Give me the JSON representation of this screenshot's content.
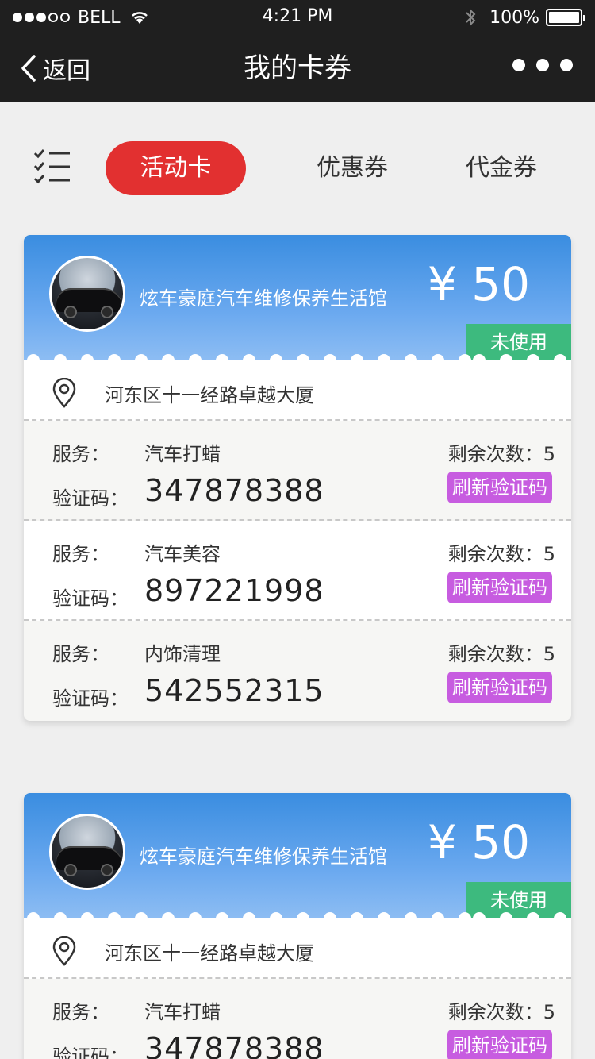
{
  "status_bar": {
    "carrier": "BELL",
    "time": "4:21 PM",
    "battery": "100%"
  },
  "nav": {
    "back_label": "返回",
    "title": "我的卡券"
  },
  "tabs": [
    {
      "label": "活动卡",
      "active": true
    },
    {
      "label": "优惠券",
      "active": false
    },
    {
      "label": "代金券",
      "active": false
    }
  ],
  "cards": [
    {
      "shop": "炫车豪庭汽车维修保养生活馆",
      "price": "¥ 50",
      "status": "未使用",
      "address": "河东区十一经路卓越大厦",
      "services": [
        {
          "service_label": "服务：",
          "name": "汽车打蜡",
          "remaining": "剩余次数：5",
          "code_label": "验证码：",
          "code": "347878388",
          "refresh_label": "刷新验证码"
        },
        {
          "service_label": "服务：",
          "name": "汽车美容",
          "remaining": "剩余次数：5",
          "code_label": "验证码：",
          "code": "897221998",
          "refresh_label": "刷新验证码"
        },
        {
          "service_label": "服务：",
          "name": "内饰清理",
          "remaining": "剩余次数：5",
          "code_label": "验证码：",
          "code": "542552315",
          "refresh_label": "刷新验证码"
        }
      ]
    },
    {
      "shop": "炫车豪庭汽车维修保养生活馆",
      "price": "¥ 50",
      "status": "未使用",
      "address": "河东区十一经路卓越大厦",
      "services": [
        {
          "service_label": "服务：",
          "name": "汽车打蜡",
          "remaining": "剩余次数：5",
          "code_label": "验证码：",
          "code": "347878388",
          "refresh_label": "刷新验证码"
        }
      ]
    }
  ],
  "colors": {
    "accent_red": "#e23030",
    "card_blue": "#3a8de0",
    "status_green": "#3dba7e",
    "refresh_purple": "#c75ce0"
  }
}
